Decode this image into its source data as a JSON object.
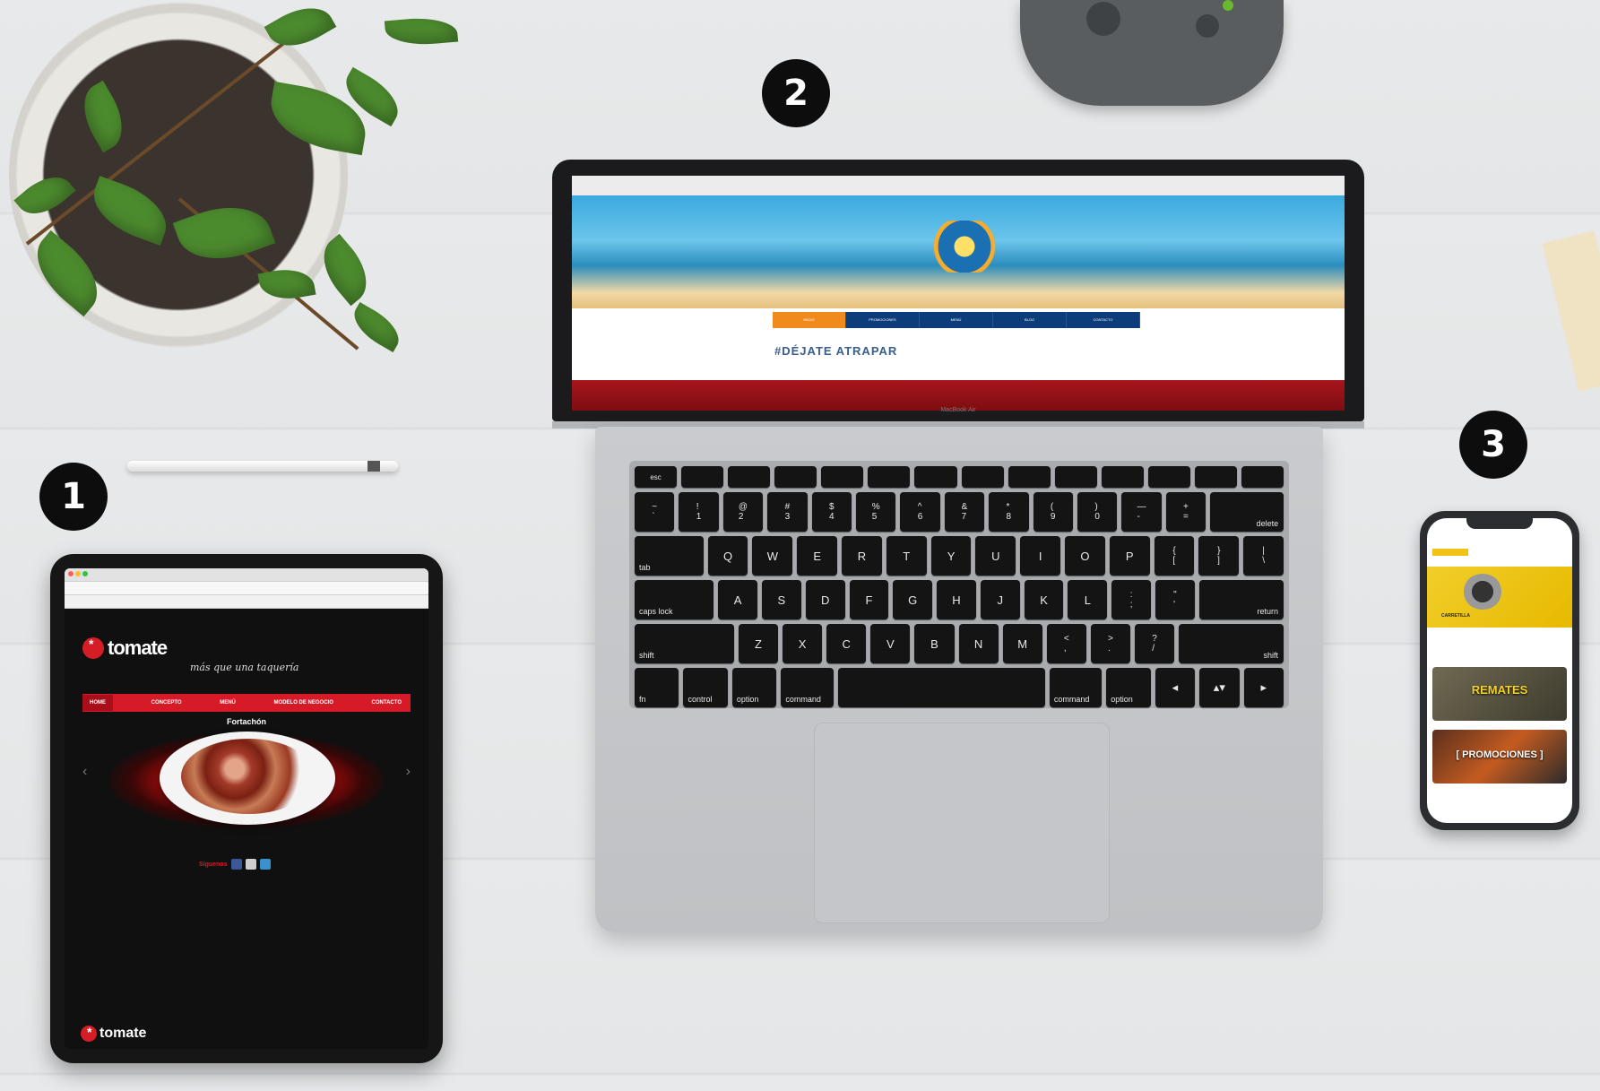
{
  "badges": {
    "one": "1",
    "two": "2",
    "three": "3"
  },
  "tablet": {
    "brand": "tomate",
    "tagline": "más que una taquería",
    "nav": [
      "HOME",
      "CONCEPTO",
      "MENÚ",
      "MODELO DE NEGOCIO",
      "CONTACTO"
    ],
    "dish_title": "Fortachón",
    "arrow_left": "‹",
    "arrow_right": "›",
    "social_label": "Síguenos",
    "footer_brand": "tomate"
  },
  "laptop": {
    "nav": [
      "INICIO",
      "PROMOCIONES",
      "MENÚ",
      "BLOG",
      "CONTACTO"
    ],
    "hashtag": "#DÉJATE ATRAPAR",
    "brand": "MacBook Air"
  },
  "keyboard": {
    "fn_row": [
      "esc",
      "",
      "",
      "",
      "",
      "",
      "",
      "",
      "",
      "",
      "",
      "",
      "",
      ""
    ],
    "row1": [
      "~\n`",
      "!\n1",
      "@\n2",
      "#\n3",
      "$\n4",
      "%\n5",
      "^\n6",
      "&\n7",
      "*\n8",
      "(\n9",
      ")\n0",
      "—\n-",
      "+\n=",
      "delete"
    ],
    "row2": [
      "tab",
      "Q",
      "W",
      "E",
      "R",
      "T",
      "Y",
      "U",
      "I",
      "O",
      "P",
      "{\n[",
      "}\n]",
      "|\n\\"
    ],
    "row3": [
      "caps lock",
      "A",
      "S",
      "D",
      "F",
      "G",
      "H",
      "J",
      "K",
      "L",
      ":\n;",
      "\"\n'",
      "return"
    ],
    "row4": [
      "shift",
      "Z",
      "X",
      "C",
      "V",
      "B",
      "N",
      "M",
      "<\n,",
      ">\n.",
      "?\n/",
      "shift"
    ],
    "row5": [
      "fn",
      "control",
      "option",
      "command",
      "",
      "command",
      "option",
      "◂",
      "▴▾",
      "▸"
    ]
  },
  "phone": {
    "label1": "CARRETILLA",
    "label2": "REMATES",
    "label3": "[ PROMOCIONES ]"
  }
}
